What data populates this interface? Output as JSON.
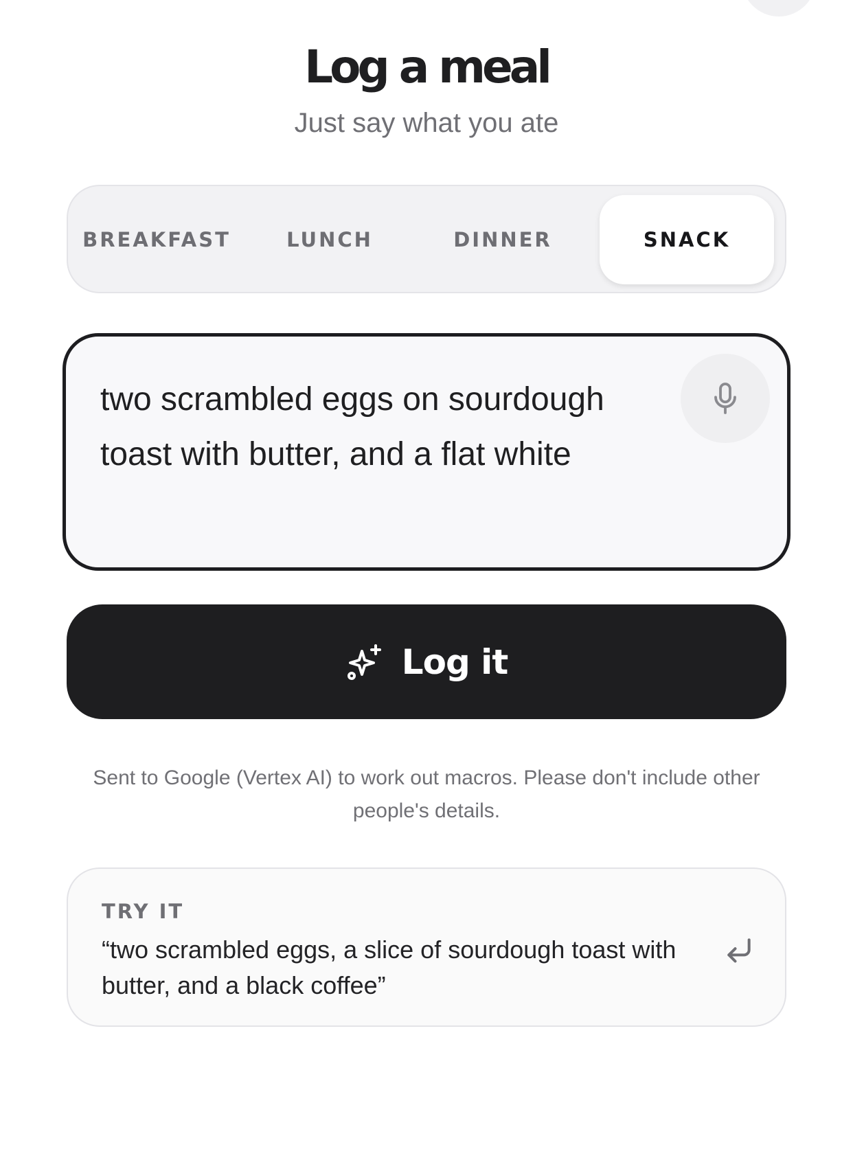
{
  "header": {
    "title": "Log a meal",
    "subtitle": "Just say what you ate"
  },
  "meal_tabs": {
    "items": [
      {
        "label": "BREAKFAST",
        "active": false
      },
      {
        "label": "LUNCH",
        "active": false
      },
      {
        "label": "DINNER",
        "active": false
      },
      {
        "label": "SNACK",
        "active": true
      }
    ],
    "selected": "SNACK"
  },
  "meal_input": {
    "value": "two scrambled eggs on sourdough toast with butter, and a flat white",
    "mic_icon": "microphone-icon"
  },
  "log_button": {
    "label": "Log it",
    "icon": "sparkles-icon"
  },
  "privacy_note": "Sent to Google (Vertex AI) to work out macros. Please don't include other people's details.",
  "try_it": {
    "label": "TRY IT",
    "example": "“two scrambled eggs, a slice of sourdough toast with butter, and a black coffee”",
    "icon": "enter-icon"
  },
  "colors": {
    "primary": "#1e1e20",
    "muted_text": "#6f6f74",
    "tab_track": "#f2f2f4",
    "input_bg": "#f8f8fa"
  }
}
